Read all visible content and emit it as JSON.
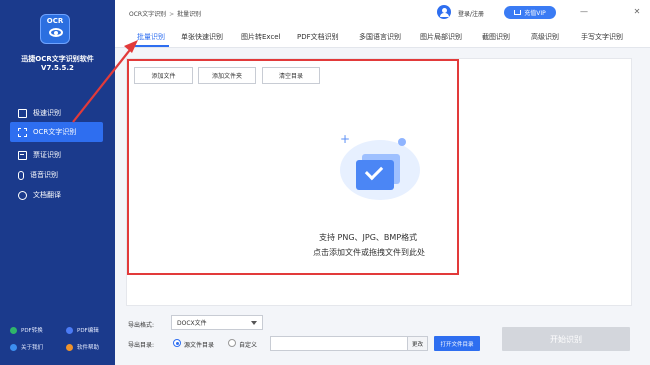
{
  "app": {
    "logo_text": "OCR",
    "name": "迅捷OCR文字识别软件",
    "version": "V7.5.5.2"
  },
  "sidebar": {
    "items": [
      {
        "label": "极速识别",
        "icon": "bolt-icon",
        "active": false
      },
      {
        "label": "OCR文字识别",
        "icon": "scan-text-icon",
        "active": true
      },
      {
        "label": "票证识别",
        "icon": "card-icon",
        "active": false
      },
      {
        "label": "语音识别",
        "icon": "mic-icon",
        "active": false
      },
      {
        "label": "文档翻译",
        "icon": "translate-icon",
        "active": false
      }
    ],
    "footer": [
      {
        "label": "PDF转换",
        "icon": "pdf-convert-icon",
        "color": "#2fb56a"
      },
      {
        "label": "PDF编辑",
        "icon": "pdf-edit-icon",
        "color": "#4b7bf5"
      },
      {
        "label": "关于我们",
        "icon": "about-icon",
        "color": "#3c8ef0"
      },
      {
        "label": "软件帮助",
        "icon": "help-icon",
        "color": "#f0932b"
      }
    ]
  },
  "header": {
    "breadcrumb": [
      "OCR文字识别",
      "批量识别"
    ],
    "breadcrumb_sep": ">",
    "login_label": "登录/注册",
    "vip_label": "充值VIP",
    "minimize": "—",
    "close": "✕"
  },
  "tabs": [
    {
      "label": "批量识别",
      "active": true
    },
    {
      "label": "单张快速识别"
    },
    {
      "label": "图片转Excel"
    },
    {
      "label": "PDF文档识别"
    },
    {
      "label": "多国语言识别"
    },
    {
      "label": "图片局部识别"
    },
    {
      "label": "截图识别"
    },
    {
      "label": "高级识别"
    },
    {
      "label": "手写文字识别"
    }
  ],
  "toolbar": {
    "add_file": "添加文件",
    "add_folder": "添加文件夹",
    "clear_list": "清空目录"
  },
  "dropzone": {
    "plus": "+",
    "support_text": "支持 PNG、JPG、BMP格式",
    "hint_text": "点击添加文件或拖拽文件到此处"
  },
  "output": {
    "format_label": "导出格式:",
    "format_value": "DOCX文件",
    "dir_label": "导出目录:",
    "radio_source": "源文件目录",
    "radio_custom": "自定义",
    "path_value": "",
    "change_label": "更改",
    "open_folder_label": "打开文件目录",
    "start_label": "开始识别"
  },
  "colors": {
    "sidebar_bg": "#1b3a8c",
    "accent": "#2e6ef0",
    "annotation_red": "#e23a3a"
  }
}
